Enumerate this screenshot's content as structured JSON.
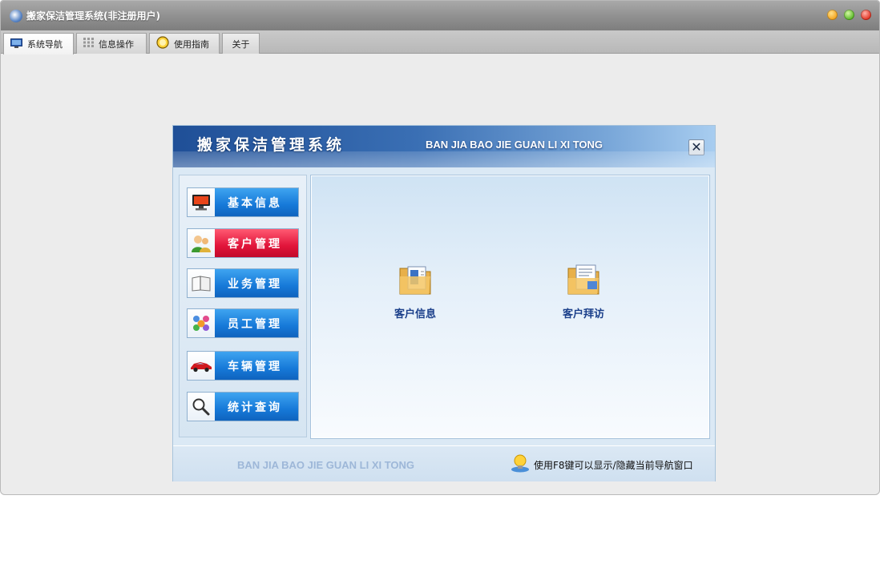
{
  "window": {
    "title": "搬家保洁管理系统(非注册用户)"
  },
  "window_controls": [
    "minimize",
    "maximize",
    "close"
  ],
  "tabs": [
    {
      "label": "系统导航",
      "icon": "monitor-icon",
      "active": true
    },
    {
      "label": "信息操作",
      "icon": "grid-icon",
      "active": false
    },
    {
      "label": "使用指南",
      "icon": "help-circle-icon",
      "active": false
    },
    {
      "label": "关于",
      "icon": "",
      "active": false
    }
  ],
  "panel": {
    "title": "搬家保洁管理系统",
    "subtitle": "BAN JIA BAO JIE GUAN LI XI TONG",
    "close_symbol": "✕"
  },
  "sidebar": {
    "items": [
      {
        "label": "基本信息",
        "icon": "monitor-icon",
        "active": false
      },
      {
        "label": "客户管理",
        "icon": "users-icon",
        "active": true
      },
      {
        "label": "业务管理",
        "icon": "book-icon",
        "active": false
      },
      {
        "label": "员工管理",
        "icon": "people-group-icon",
        "active": false
      },
      {
        "label": "车辆管理",
        "icon": "car-icon",
        "active": false
      },
      {
        "label": "统计查询",
        "icon": "magnifier-icon",
        "active": false
      }
    ]
  },
  "content": {
    "functions": [
      {
        "label": "客户信息",
        "icon": "folder-document-icon"
      },
      {
        "label": "客户拜访",
        "icon": "folder-report-icon"
      }
    ]
  },
  "footer": {
    "text": "BAN JIA BAO JIE GUAN LI XI TONG",
    "hint": "使用F8键可以显示/隐藏当前导航窗口",
    "hint_icon": "lightbulb-icon"
  },
  "colors": {
    "nav_blue": "#1679d8",
    "nav_active_red": "#e1143a",
    "banner_dark": "#1f4f97",
    "function_label": "#1a3f8a"
  }
}
